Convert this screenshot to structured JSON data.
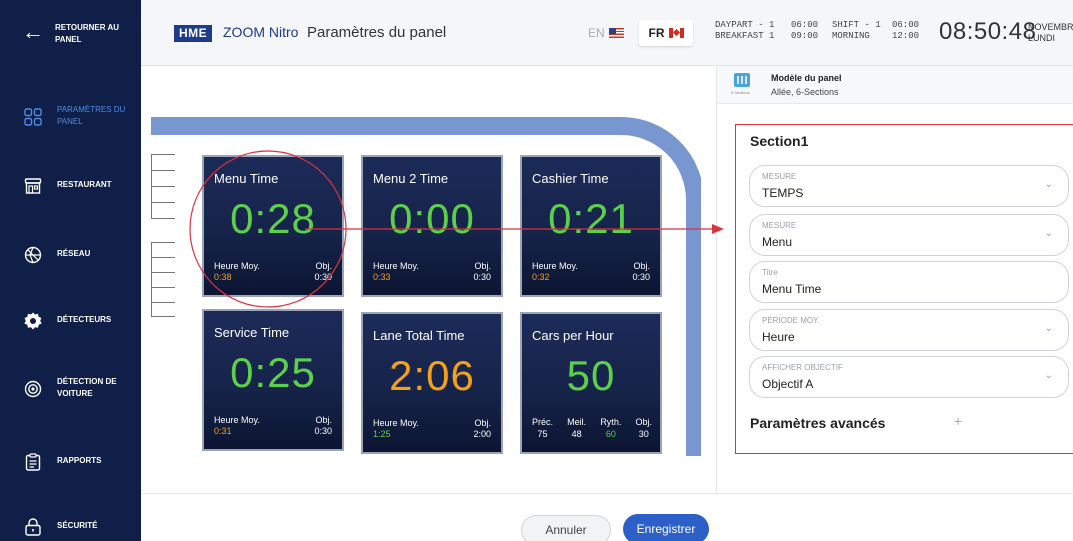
{
  "sidebar": {
    "back_label": "RETOURNER AU PANEL",
    "items": [
      {
        "label": "PARAMÈTRES DU PANEL",
        "icon": "panel-grid-icon",
        "active": true
      },
      {
        "label": "RESTAURANT",
        "icon": "store-icon"
      },
      {
        "label": "RÉSEAU",
        "icon": "network-icon"
      },
      {
        "label": "DÉTECTEURS",
        "icon": "gear-icon"
      },
      {
        "label": "DÉTECTION DE VOITURE",
        "icon": "car-detection-icon"
      },
      {
        "label": "RAPPORTS",
        "icon": "clipboard-icon"
      },
      {
        "label": "SÉCURITÉ",
        "icon": "lock-icon"
      }
    ]
  },
  "header": {
    "logo_brand": "HME",
    "logo_product": "ZOOM Nitro",
    "title": "Paramètres du panel",
    "lang_en": "EN",
    "lang_fr": "FR",
    "daypart_label": "DAYPART - 1",
    "daypart_name": "BREAKFAST 1",
    "daypart_start": "06:00",
    "daypart_end": "09:00",
    "shift_label": "SHIFT - 1",
    "shift_name": "MORNING",
    "shift_start": "06:00",
    "shift_end": "12:00",
    "clock": "08:50:48",
    "date_month": "NOVEMBRE",
    "date_day": "LUNDI"
  },
  "tiles": [
    {
      "name": "Menu Time",
      "value": "0:28",
      "value_color": "green",
      "avg_label": "Heure Moy.",
      "avg_value": "0:38",
      "obj_label": "Obj.",
      "obj_value": "0:30"
    },
    {
      "name": "Menu 2 Time",
      "value": "0:00",
      "value_color": "green",
      "avg_label": "Heure Moy.",
      "avg_value": "0:33",
      "obj_label": "Obj.",
      "obj_value": "0:30"
    },
    {
      "name": "Cashier Time",
      "value": "0:21",
      "value_color": "green",
      "avg_label": "Heure Moy.",
      "avg_value": "0:32",
      "obj_label": "Obj.",
      "obj_value": "0:30"
    },
    {
      "name": "Service Time",
      "value": "0:25",
      "value_color": "green",
      "avg_label": "Heure Moy.",
      "avg_value": "0:31",
      "obj_label": "Obj.",
      "obj_value": "0:30"
    },
    {
      "name": "Lane Total Time",
      "value": "2:06",
      "value_color": "orange",
      "avg_label": "Heure Moy.",
      "avg_value": "1:25",
      "obj_label": "Obj.",
      "obj_value": "2:00"
    },
    {
      "name": "Cars per Hour",
      "value": "50",
      "value_color": "green",
      "stats": [
        {
          "label": "Préc.",
          "value": "75"
        },
        {
          "label": "Meil.",
          "value": "48"
        },
        {
          "label": "Ryth.",
          "value": "60"
        },
        {
          "label": "Obj.",
          "value": "30"
        }
      ]
    }
  ],
  "buttons": {
    "cancel": "Annuler",
    "save": "Enregistrer"
  },
  "panel": {
    "model_title": "Modèle du panel",
    "model_subtitle": "Allée, 6-Sections",
    "model_icon_label": "6 Sections",
    "section_title": "Section1",
    "fields": [
      {
        "label": "MESURE",
        "value": "TEMPS",
        "type": "select"
      },
      {
        "label": "MESURE",
        "value": "Menu",
        "type": "select"
      },
      {
        "label": "Titre",
        "value": "Menu Time",
        "type": "text"
      },
      {
        "label": "PÉRIODE MOY.",
        "value": "Heure",
        "type": "select"
      },
      {
        "label": "AFFICHER OBJECTIF",
        "value": "Objectif A",
        "type": "select"
      }
    ],
    "advanced_label": "Paramètres avancés",
    "advanced_icon": "plus-icon"
  },
  "colors": {
    "sidebar_bg": "#0f1f47",
    "active_nav": "#4e8ce6",
    "tile_green": "#5cd04a",
    "tile_orange": "#f3a11c",
    "lane": "#7896cf",
    "annotation_red": "#d93340",
    "save_button": "#2c5fc7"
  }
}
